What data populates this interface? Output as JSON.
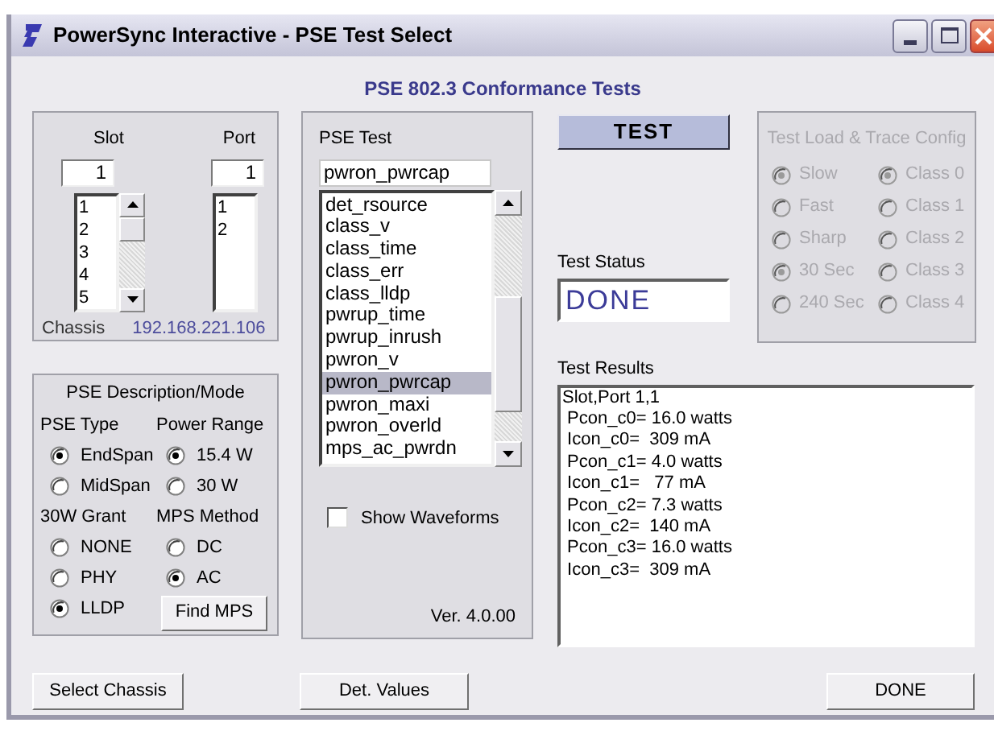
{
  "window": {
    "title": "PowerSync Interactive - PSE Test Select"
  },
  "heading": "PSE 802.3 Conformance Tests",
  "slot": {
    "label": "Slot",
    "value": "1",
    "items": [
      "1",
      "2",
      "3",
      "4",
      "5"
    ]
  },
  "port": {
    "label": "Port",
    "value": "1",
    "items": [
      "1",
      "2"
    ]
  },
  "chassis": {
    "label": "Chassis",
    "address": "192.168.221.106"
  },
  "description": {
    "title": "PSE Description/Mode",
    "groups": [
      {
        "label": "PSE Type",
        "options": [
          {
            "label": "EndSpan",
            "selected": true
          },
          {
            "label": "MidSpan",
            "selected": false
          }
        ]
      },
      {
        "label": "Power Range",
        "options": [
          {
            "label": "15.4 W",
            "selected": true
          },
          {
            "label": "30 W",
            "selected": false
          }
        ]
      },
      {
        "label": "30W Grant",
        "options": [
          {
            "label": "NONE",
            "selected": false
          },
          {
            "label": "PHY",
            "selected": false
          },
          {
            "label": "LLDP",
            "selected": true
          }
        ]
      },
      {
        "label": "MPS Method",
        "options": [
          {
            "label": "DC",
            "selected": false
          },
          {
            "label": "AC",
            "selected": true
          }
        ]
      }
    ],
    "find_button": "Find MPS"
  },
  "pse_test": {
    "label": "PSE Test",
    "value": "pwron_pwrcap",
    "items": [
      {
        "label": "det_rsource",
        "selected": false
      },
      {
        "label": "class_v",
        "selected": false
      },
      {
        "label": "class_time",
        "selected": false
      },
      {
        "label": "class_err",
        "selected": false
      },
      {
        "label": "class_lldp",
        "selected": false
      },
      {
        "label": "pwrup_time",
        "selected": false
      },
      {
        "label": "pwrup_inrush",
        "selected": false
      },
      {
        "label": "pwron_v",
        "selected": false
      },
      {
        "label": "pwron_pwrcap",
        "selected": true
      },
      {
        "label": "pwron_maxi",
        "selected": false
      },
      {
        "label": "pwron_overld",
        "selected": false
      },
      {
        "label": "mps_ac_pwrdn",
        "selected": false
      }
    ],
    "show_waveforms": {
      "label": "Show Waveforms",
      "checked": false
    },
    "version": "Ver. 4.0.00"
  },
  "test_button": "TEST",
  "test_status": {
    "label": "Test Status",
    "value": "DONE"
  },
  "load_config": {
    "title": "Test Load & Trace Config",
    "disabled": true,
    "columns": [
      [
        {
          "label": "Slow",
          "selected": true
        },
        {
          "label": "Fast",
          "selected": false
        },
        {
          "label": "Sharp",
          "selected": false
        },
        {
          "label": "30 Sec",
          "selected": true
        },
        {
          "label": "240 Sec",
          "selected": false
        }
      ],
      [
        {
          "label": "Class 0",
          "selected": true
        },
        {
          "label": "Class 1",
          "selected": false
        },
        {
          "label": "Class 2",
          "selected": false
        },
        {
          "label": "Class 3",
          "selected": false
        },
        {
          "label": "Class 4",
          "selected": false
        }
      ]
    ]
  },
  "test_results": {
    "label": "Test Results",
    "lines": [
      "Slot,Port 1,1",
      " Pcon_c0= 16.0 watts",
      " Icon_c0=  309 mA",
      " Pcon_c1= 4.0 watts",
      " Icon_c1=   77 mA",
      " Pcon_c2= 7.3 watts",
      " Icon_c2=  140 mA",
      " Pcon_c3= 16.0 watts",
      " Icon_c3=  309 mA"
    ]
  },
  "buttons": [
    {
      "label": "Select Chassis"
    },
    {
      "label": "Det. Values"
    },
    {
      "label": "DONE"
    }
  ]
}
